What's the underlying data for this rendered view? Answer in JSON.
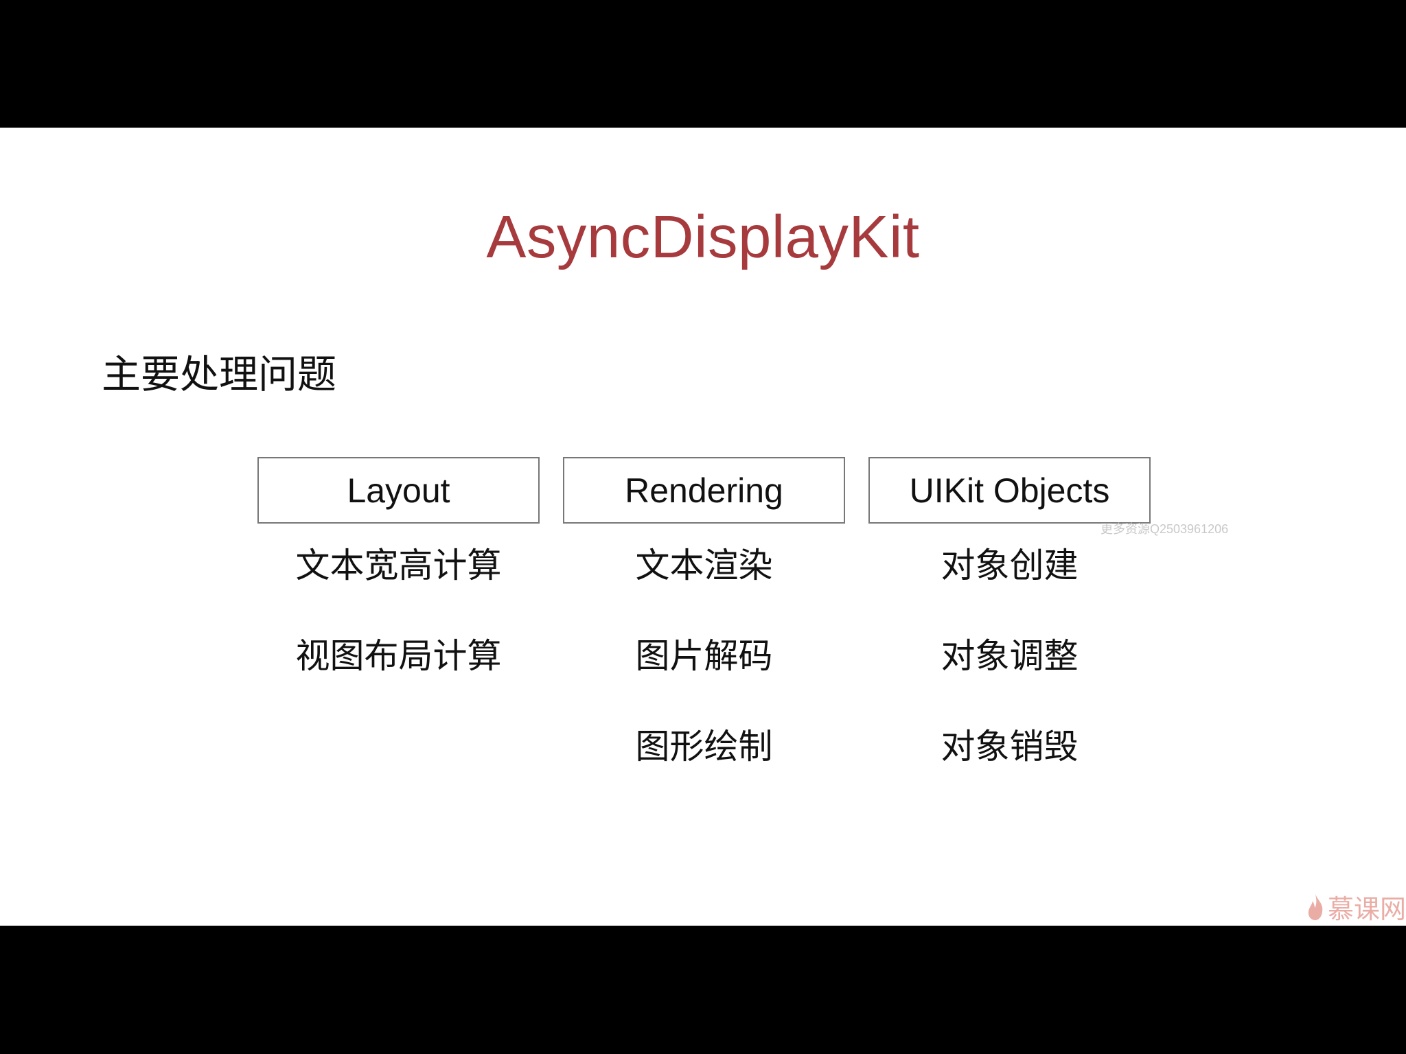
{
  "slide": {
    "title": "AsyncDisplayKit",
    "subtitle": "主要处理问题",
    "columns": [
      {
        "header": "Layout",
        "items": [
          "文本宽高计算",
          "视图布局计算"
        ]
      },
      {
        "header": "Rendering",
        "items": [
          "文本渲染",
          "图片解码",
          "图形绘制"
        ]
      },
      {
        "header": "UIKit Objects",
        "items": [
          "对象创建",
          "对象调整",
          "对象销毁"
        ]
      }
    ]
  },
  "watermark": {
    "text": "更多资源Q2503961206",
    "brand": "慕课网"
  },
  "colors": {
    "title": "#a63a3d",
    "box_border": "#777777",
    "background": "#ffffff",
    "letterbox": "#000000"
  }
}
